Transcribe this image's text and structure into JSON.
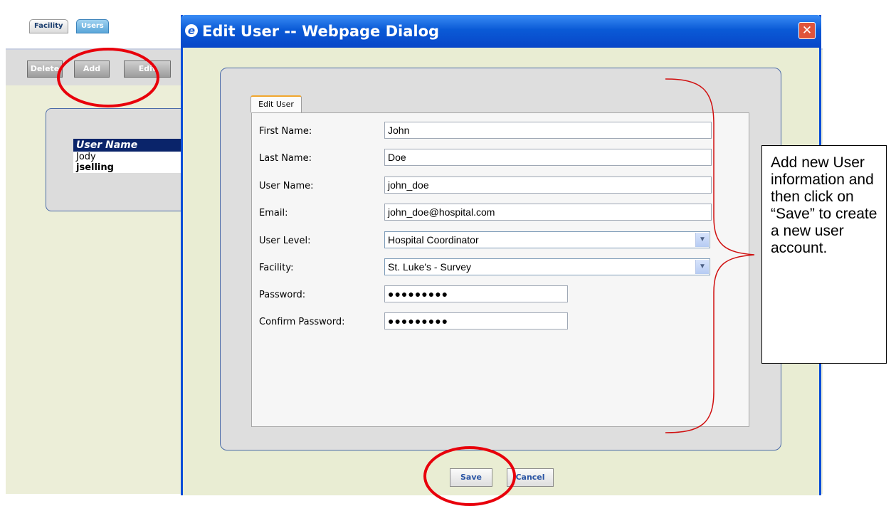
{
  "background_app": {
    "tabs": [
      "Facility",
      "Users"
    ],
    "toolbar": {
      "delete_label": "Delete",
      "add_label": "Add",
      "edit_label": "Edit"
    },
    "user_list": {
      "header": "User Name",
      "items": [
        "Jody",
        "jselling"
      ]
    }
  },
  "dialog": {
    "title": "Edit User -- Webpage Dialog",
    "tab_label": "Edit User",
    "fields": {
      "first_name": {
        "label": "First Name:",
        "value": "John"
      },
      "last_name": {
        "label": "Last Name:",
        "value": "Doe"
      },
      "user_name": {
        "label": "User Name:",
        "value": "john_doe"
      },
      "email": {
        "label": "Email:",
        "value": "john_doe@hospital.com"
      },
      "user_level": {
        "label": "User Level:",
        "value": "Hospital Coordinator"
      },
      "facility": {
        "label": "Facility:",
        "value": "St. Luke's - Survey"
      },
      "password": {
        "label": "Password:",
        "value": "●●●●●●●●●"
      },
      "confirm_password": {
        "label": "Confirm Password:",
        "value": "●●●●●●●●●"
      }
    },
    "buttons": {
      "save_label": "Save",
      "cancel_label": "Cancel"
    }
  },
  "callout": {
    "text": "Add new User information and then click on “Save” to create a new user account."
  },
  "colors": {
    "highlight_circle": "#e8000b",
    "title_bar": "#0a5ad6",
    "bracket": "#d01010"
  }
}
